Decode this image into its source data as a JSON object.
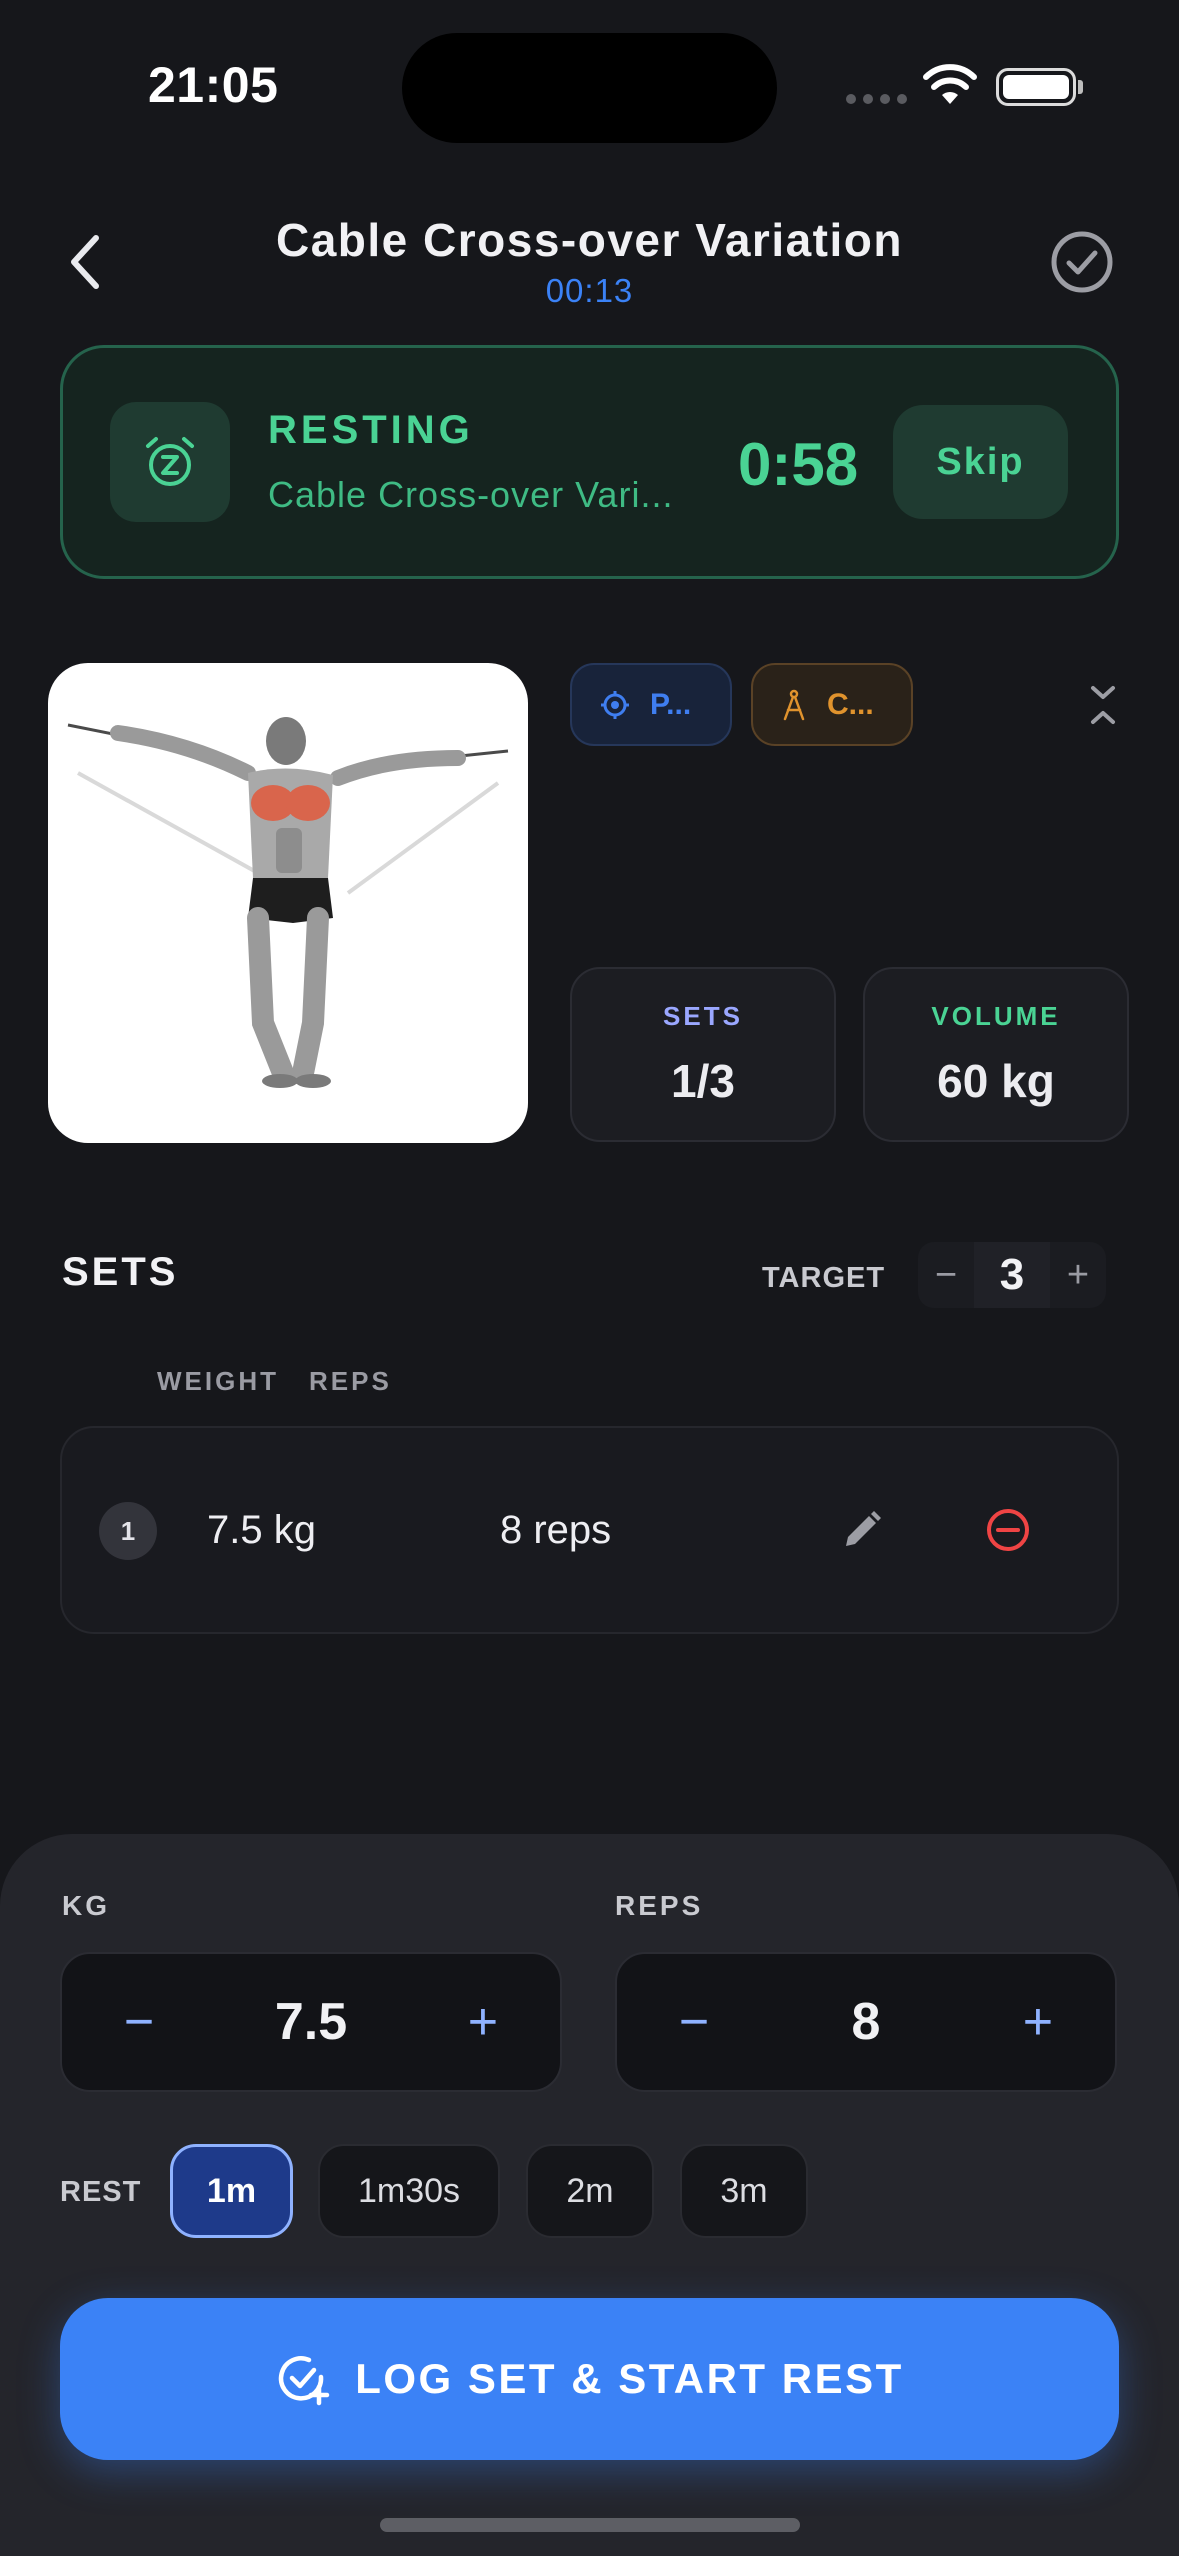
{
  "status_bar": {
    "time": "21:05"
  },
  "header": {
    "title": "Cable Cross-over Variation",
    "elapsed": "00:13"
  },
  "rest_banner": {
    "label": "RESTING",
    "exercise": "Cable Cross-over Vari...",
    "remaining": "0:58",
    "skip_label": "Skip"
  },
  "tags": {
    "primary": "P...",
    "equipment": "C..."
  },
  "stats": {
    "sets_label": "SETS",
    "sets_value": "1/3",
    "volume_label": "VOLUME",
    "volume_value": "60 kg"
  },
  "sets_section": {
    "title": "SETS",
    "target_label": "TARGET",
    "target_value": "3",
    "minus": "−",
    "plus": "+",
    "col_weight": "WEIGHT",
    "col_reps": "REPS",
    "rows": [
      {
        "num": "1",
        "weight": "7.5 kg",
        "reps": "8 reps"
      }
    ]
  },
  "input_panel": {
    "kg_label": "KG",
    "kg_value": "7.5",
    "reps_label": "REPS",
    "reps_value": "8",
    "minus": "−",
    "plus": "+",
    "rest_label": "REST",
    "rest_options": [
      "1m",
      "1m30s",
      "2m",
      "3m"
    ],
    "rest_selected": "1m",
    "log_button": "LOG SET & START REST"
  },
  "colors": {
    "accent": "#3b82f6",
    "rest_green": "#4ad394",
    "danger": "#ef4444",
    "equipment_orange": "#e0932d"
  },
  "icons": [
    "back-chevron-icon",
    "check-circle-icon",
    "alarm-snooze-icon",
    "target-icon",
    "compass-icon",
    "collapse-chevron-icon",
    "pencil-icon",
    "minus-circle-icon",
    "check-plus-icon"
  ]
}
